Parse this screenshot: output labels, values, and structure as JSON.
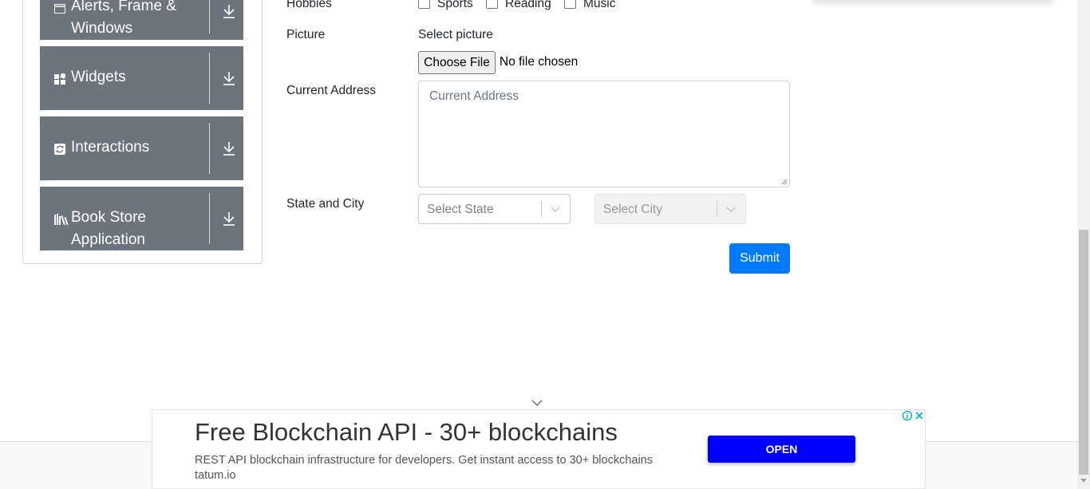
{
  "sidebar": {
    "groups": [
      {
        "label_line1": "Alerts, Frame &",
        "label_line2": "Windows",
        "icon": "window-icon"
      },
      {
        "label": "Widgets",
        "icon": "widgets-icon"
      },
      {
        "label": "Interactions",
        "icon": "interactions-icon"
      },
      {
        "label_line1": "Book Store",
        "label_line2": "Application",
        "icon": "books-icon"
      }
    ]
  },
  "form": {
    "hobbies_label": "Hobbies",
    "hobbies": [
      "Sports",
      "Reading",
      "Music"
    ],
    "picture_label": "Picture",
    "picture_hint": "Select picture",
    "file_button": "Choose File",
    "file_status": "No file chosen",
    "address_label": "Current Address",
    "address_placeholder": "Current Address",
    "state_city_label": "State and City",
    "state_placeholder": "Select State",
    "city_placeholder": "Select City",
    "submit": "Submit"
  },
  "ad": {
    "title": "Free Blockchain API - 30+ blockchains",
    "description": "REST API blockchain infrastructure for developers. Get instant access to 30+ blockchains tatum.io",
    "button": "OPEN"
  },
  "colors": {
    "sidebar_group": "#6c757d",
    "submit_button": "#007bff",
    "ad_button": "#0000ff"
  }
}
